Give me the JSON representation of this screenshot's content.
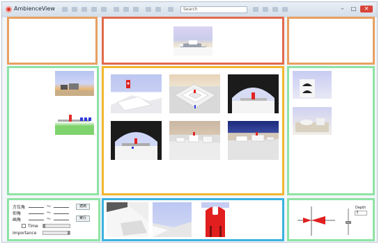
{
  "window": {
    "title": "AmbienceView",
    "search_placeholder": "Search"
  },
  "window_controls": {
    "minimize": "–",
    "maximize": "□",
    "close": "✕"
  },
  "controls": {
    "azimuth_label": "方位角",
    "elevation_label": "仰角",
    "fov_label": "画角",
    "range_sep": "〜",
    "apply_label": "適用",
    "run_label": "実行",
    "time_label": "Time",
    "importance_label": "Importance"
  },
  "depth": {
    "label": "Depth",
    "value": "3"
  },
  "colors": {
    "top": "#e8a060",
    "top_center": "#e26a4b",
    "middle": "#8ee3a5",
    "center": "#f1b72e",
    "bottom": "#8ee3a5",
    "bottom_center": "#3ab3df"
  }
}
